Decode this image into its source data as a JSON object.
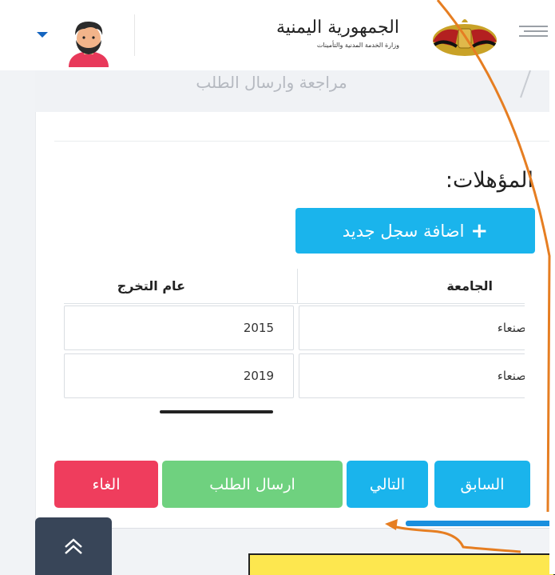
{
  "header": {
    "logo_title": "الجمهورية اليمنية",
    "logo_subtitle": "وزارة الخدمة المدنية والتأمينات",
    "menu_icon": "hamburger-menu-icon",
    "avatar_icon": "user-avatar-icon",
    "dropdown_icon": "caret-down-icon"
  },
  "stepper": {
    "current_step": "مراجعة وارسال الطلب"
  },
  "section": {
    "title": "المؤهلات:"
  },
  "add_record": {
    "label": "اضافة سجل جديد",
    "icon": "plus-icon"
  },
  "table": {
    "headers": {
      "university": "الجامعة",
      "graduation_year": "عام التخرج"
    },
    "rows": [
      {
        "university": "صنعاء",
        "graduation_year": "2015"
      },
      {
        "university": "صنعاء",
        "graduation_year": "2019"
      }
    ]
  },
  "actions": {
    "previous": "السابق",
    "next": "التالي",
    "submit": "ارسال الطلب",
    "cancel": "الغاء"
  },
  "scroll_top_icon": "double-chevron-up-icon",
  "colors": {
    "primary": "#1ab4ec",
    "success": "#6fd17f",
    "danger": "#ef3d5d",
    "dark": "#384558",
    "annotation": "#e67e22",
    "highlight": "#fde74f"
  }
}
